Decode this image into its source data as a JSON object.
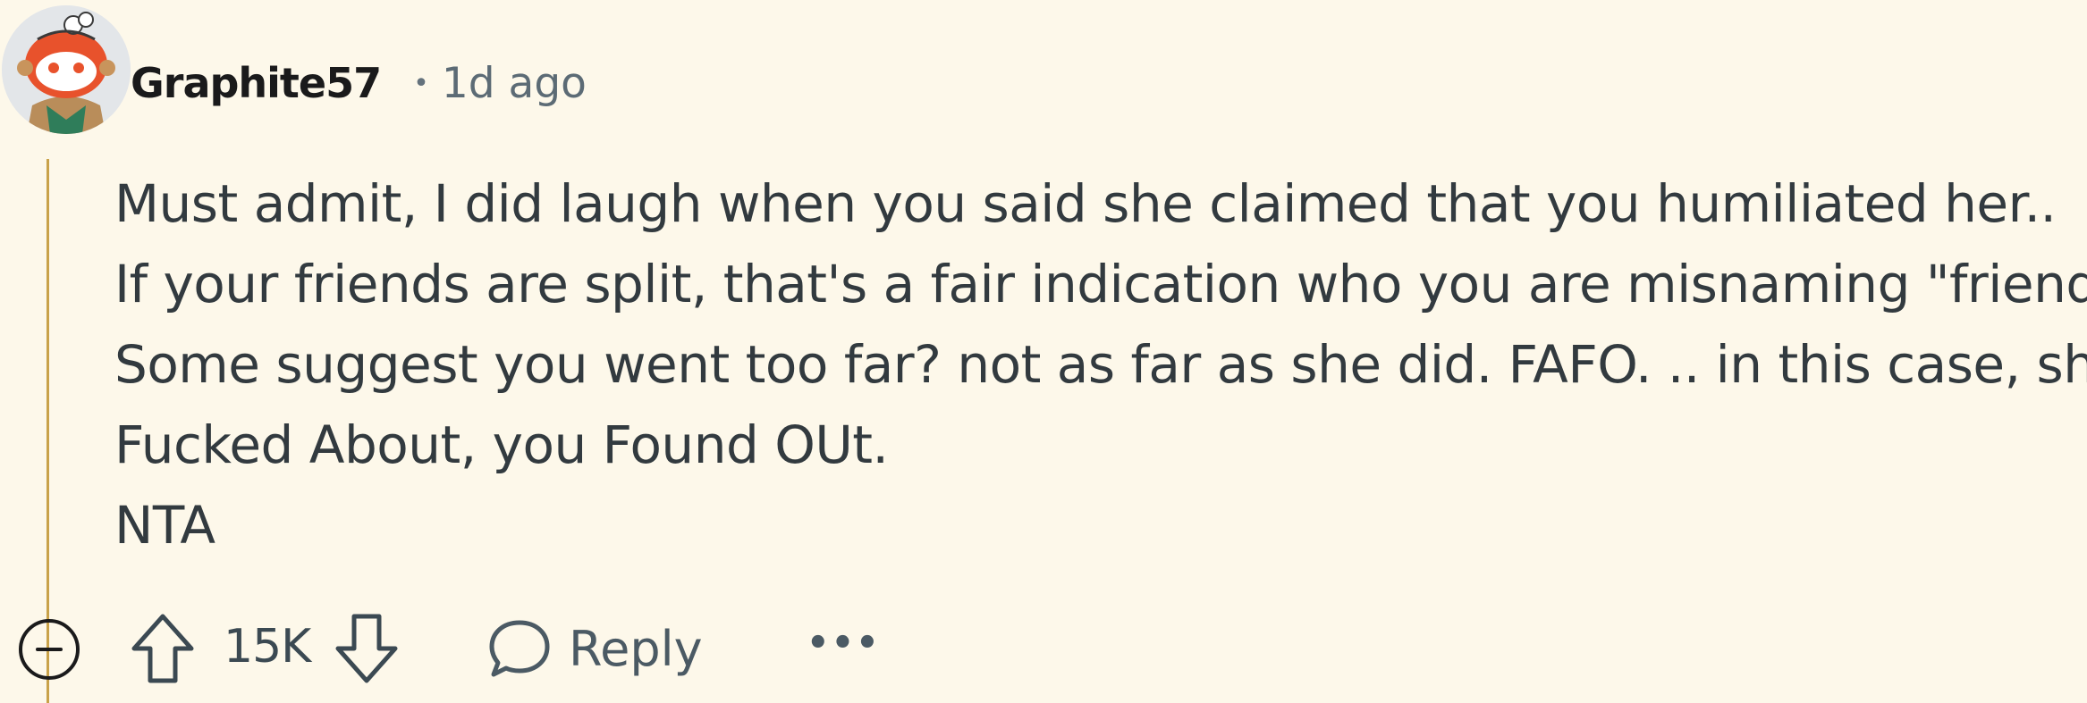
{
  "comment": {
    "username": "Graphite57",
    "separator": "•",
    "timestamp": "1d ago",
    "body": [
      "Must admit, I did laugh when you said she claimed that you humiliated her..",
      "If your friends are split, that's a fair indication who you are misnaming \"friends\"",
      "Some suggest you went too far? not as far as she did. FAFO. .. in this case, she",
      "Fucked About, you Found OUt.",
      "NTA"
    ]
  },
  "actions": {
    "collapse_icon": "collapse-minus-icon",
    "upvote_icon": "upvote-arrow-icon",
    "vote_count": "15K",
    "downvote_icon": "downvote-arrow-icon",
    "reply_icon": "speech-bubble-icon",
    "reply_label": "Reply",
    "more_label": "•••"
  },
  "colors": {
    "background": "#fdf8ea",
    "thread_line": "#c9a24a",
    "text": "#323a3f",
    "meta": "#5c6b75",
    "avatar_accent": "#e8522c"
  }
}
